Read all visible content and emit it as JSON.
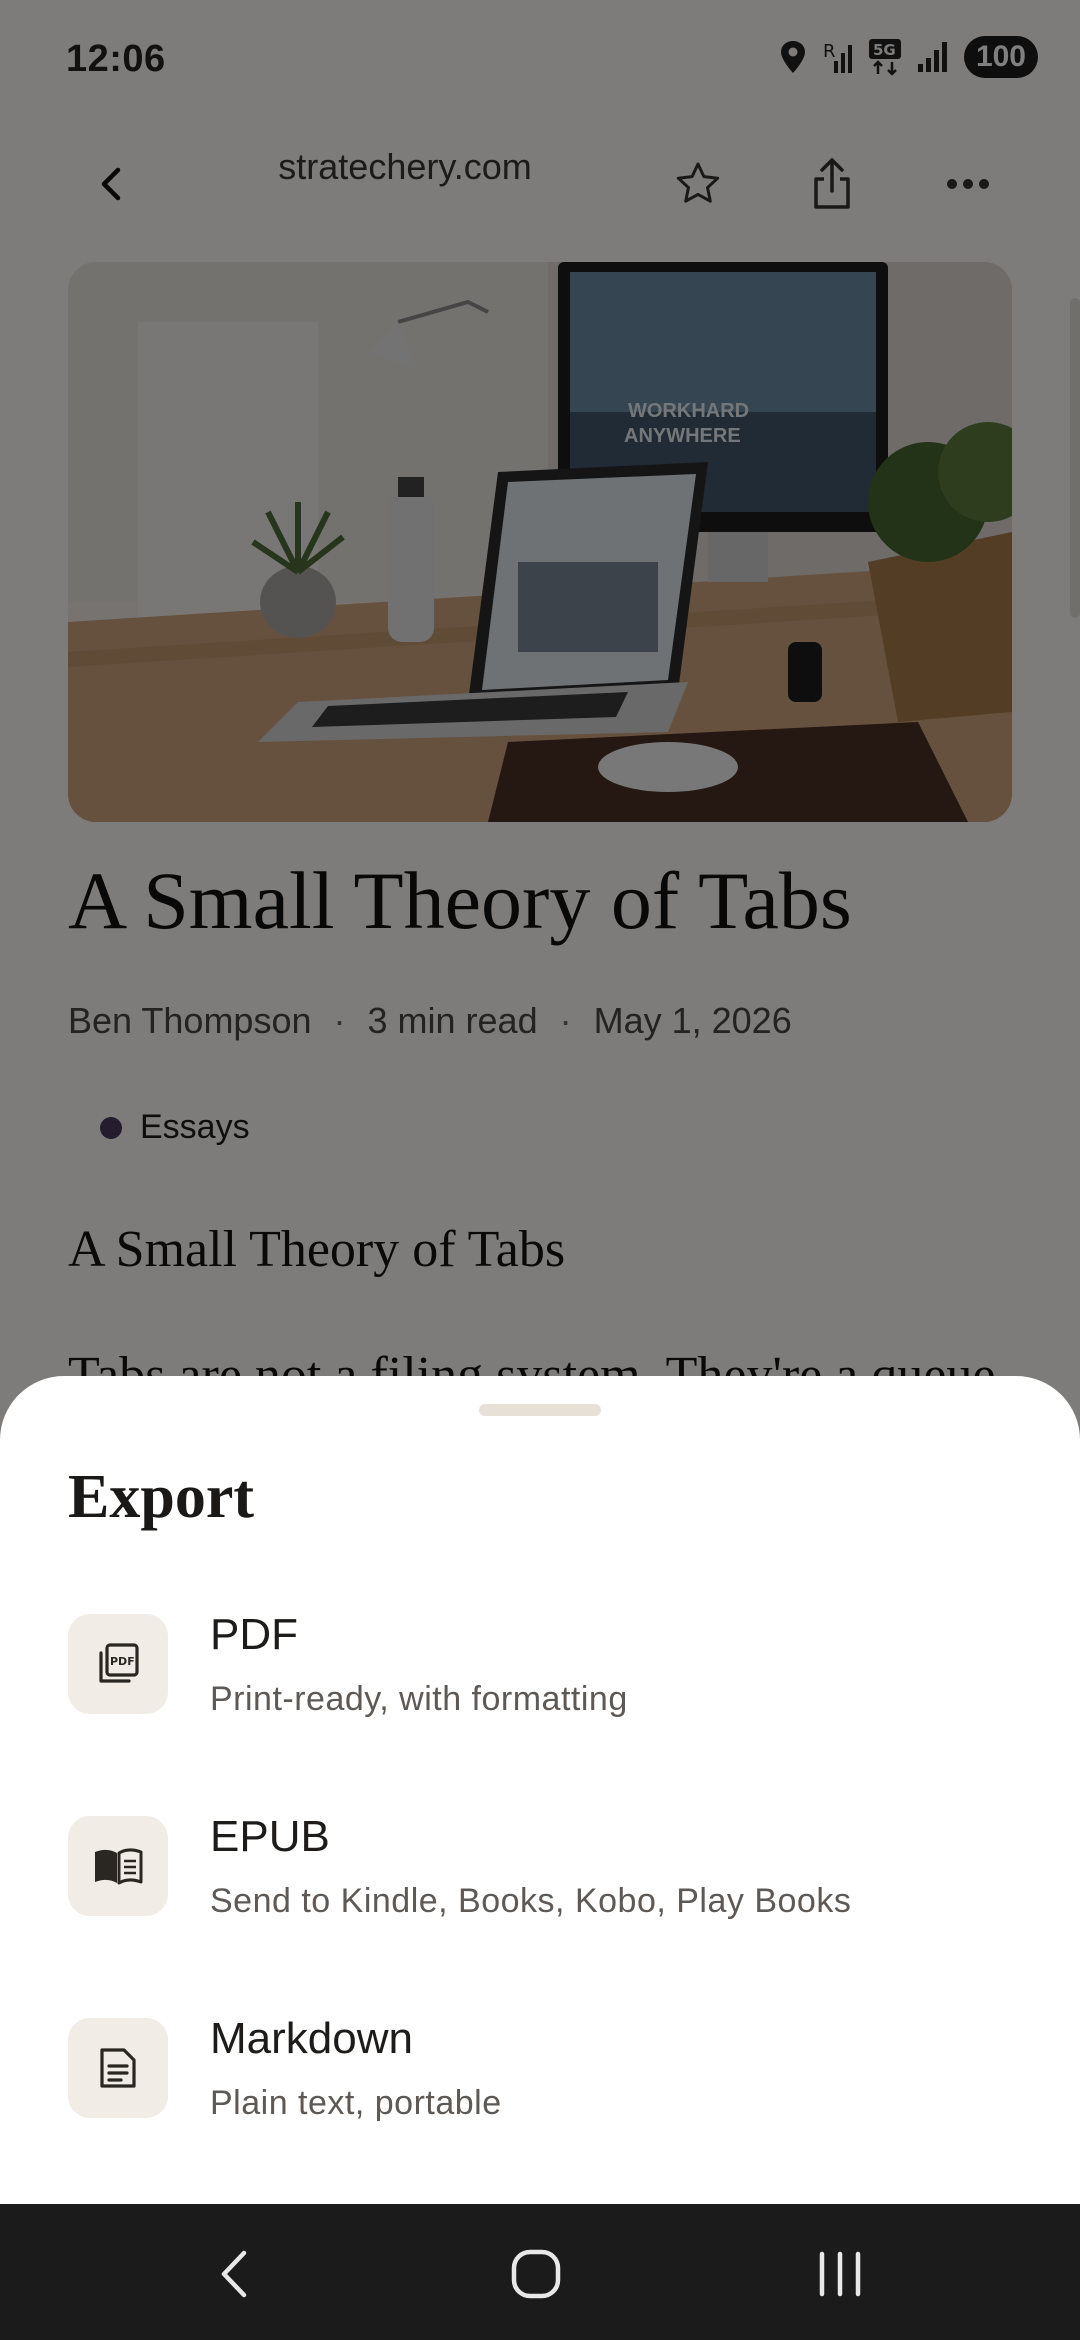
{
  "status_bar": {
    "time": "12:06",
    "battery": "100",
    "network_label": "5G"
  },
  "top_bar": {
    "domain": "stratechery.com"
  },
  "article": {
    "title": "A Small Theory of Tabs",
    "author": "Ben Thompson",
    "read_time": "3 min read",
    "date": "May 1, 2026",
    "separator": "·",
    "tag": "Essays",
    "body_heading": "A Small Theory of Tabs",
    "body_first_line": "Tabs are not a filing system. They're a queue"
  },
  "hero_image": {
    "monitor_text_1": "WORKHARD",
    "monitor_text_2": "ANYWHERE"
  },
  "sheet": {
    "title": "Export",
    "options": [
      {
        "title": "PDF",
        "subtitle": "Print-ready, with formatting",
        "icon": "pdf-icon"
      },
      {
        "title": "EPUB",
        "subtitle": "Send to Kindle, Books, Kobo, Play Books",
        "icon": "book-icon"
      },
      {
        "title": "Markdown",
        "subtitle": "Plain text, portable",
        "icon": "document-icon"
      }
    ]
  },
  "colors": {
    "tag_dot": "#4b3a5e",
    "scrim": "rgba(0,0,0,0.5)",
    "sheet_bg": "#ffffff",
    "icon_tile": "#f1ece6",
    "navbar": "#1b1b1b"
  }
}
